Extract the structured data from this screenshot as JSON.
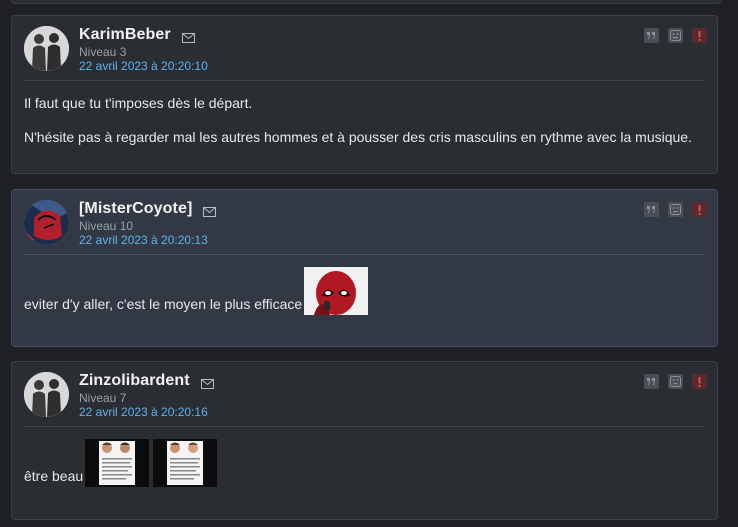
{
  "posts": [
    {
      "pseudo": "KarimBeber",
      "niveau": "Niveau 3",
      "date": "22 avril 2023 à 20:20:10",
      "paragraphs": [
        "Il faut que tu t'imposes dès le départ.",
        "N'hésite pas à regarder mal les autres hommes et à pousser des cris masculins en rythme avec la musique."
      ]
    },
    {
      "pseudo": "[MisterCoyote]",
      "niveau": "Niveau 10",
      "date": "22 avril 2023 à 20:20:13",
      "text": "eviter d'y aller, c'est le moyen le plus efficace"
    },
    {
      "pseudo": "Zinzolibardent",
      "niveau": "Niveau 7",
      "date": "22 avril 2023 à 20:20:16",
      "text": "être beau"
    }
  ],
  "icons": {
    "message": "envelope-icon",
    "quote": "quote-icon",
    "blacklist": "sad-face-icon",
    "report": "exclamation-icon"
  },
  "colors": {
    "date_link": "#5fb2ef",
    "post_bg": "#2a2d32",
    "post_alt_bg": "#333944",
    "report_bg": "#5b2a2e"
  }
}
